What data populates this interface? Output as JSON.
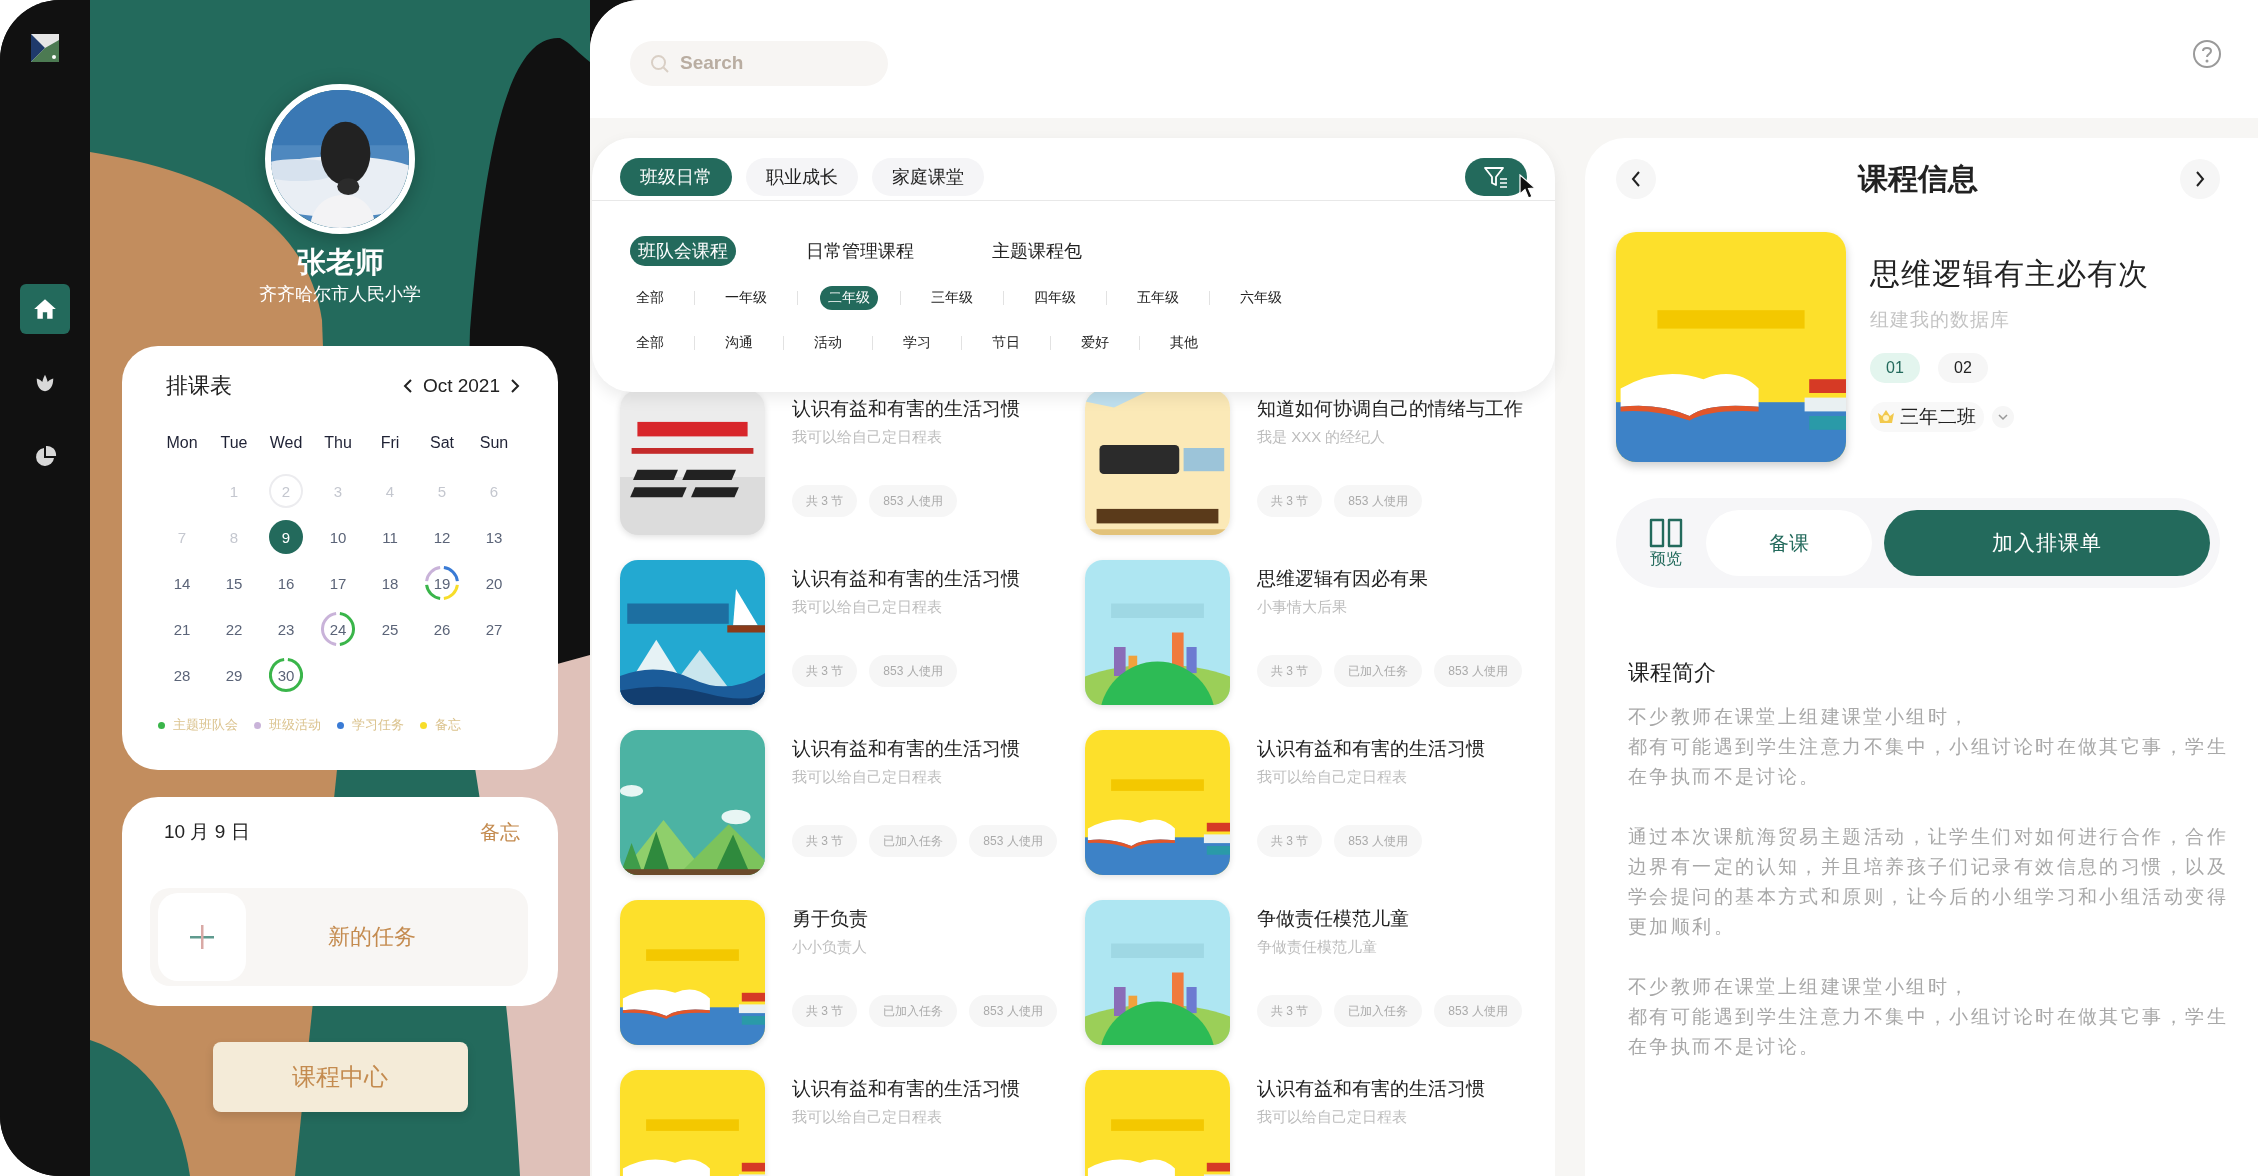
{
  "sidebar": {
    "nav_items": [
      {
        "selected": true
      },
      {
        "selected": false
      },
      {
        "selected": false
      }
    ]
  },
  "profile": {
    "name": "张老师",
    "school": "齐齐哈尔市人民小学"
  },
  "calendar": {
    "title": "排课表",
    "month": "Oct 2021",
    "weekdays": [
      "Mon",
      "Tue",
      "Wed",
      "Thu",
      "Fri",
      "Sat",
      "Sun"
    ],
    "days": [
      {
        "day": "1",
        "muted": true,
        "selected": false,
        "outlined": false
      },
      {
        "day": "2",
        "muted": true,
        "selected": false,
        "outlined": true
      },
      {
        "day": "3",
        "muted": true,
        "selected": false,
        "outlined": false
      },
      {
        "day": "4",
        "muted": true,
        "selected": false,
        "outlined": false
      },
      {
        "day": "5",
        "muted": true,
        "selected": false,
        "outlined": false
      },
      {
        "day": "6",
        "muted": true,
        "selected": false,
        "outlined": false
      },
      {
        "day": "7",
        "muted": true,
        "selected": false,
        "outlined": false
      },
      {
        "day": "8",
        "muted": true,
        "selected": false,
        "outlined": false
      },
      {
        "day": "9",
        "muted": false,
        "selected": true,
        "outlined": false
      },
      {
        "day": "10",
        "muted": false,
        "selected": false,
        "outlined": false
      },
      {
        "day": "11",
        "muted": false,
        "selected": false,
        "outlined": false
      },
      {
        "day": "12",
        "muted": false,
        "selected": false,
        "outlined": false
      },
      {
        "day": "13",
        "muted": false,
        "selected": false,
        "outlined": false
      },
      {
        "day": "14",
        "muted": false,
        "selected": false,
        "outlined": false
      },
      {
        "day": "15",
        "muted": false,
        "selected": false,
        "outlined": false
      },
      {
        "day": "16",
        "muted": false,
        "selected": false,
        "outlined": false
      },
      {
        "day": "17",
        "muted": false,
        "selected": false,
        "outlined": false
      },
      {
        "day": "18",
        "muted": false,
        "selected": false,
        "outlined": false
      },
      {
        "day": "19",
        "muted": false,
        "selected": false,
        "outlined": false,
        "events": [
          {
            "color": "#3a7bd5"
          },
          {
            "color": "#f7dd2a"
          },
          {
            "color": "#3ab54a"
          },
          {
            "color": "#c9b3d9"
          }
        ]
      },
      {
        "day": "20",
        "muted": false,
        "selected": false,
        "outlined": false
      },
      {
        "day": "21",
        "muted": false,
        "selected": false,
        "outlined": false
      },
      {
        "day": "22",
        "muted": false,
        "selected": false,
        "outlined": false
      },
      {
        "day": "23",
        "muted": false,
        "selected": false,
        "outlined": false
      },
      {
        "day": "24",
        "muted": false,
        "selected": false,
        "outlined": false,
        "events": [
          {
            "color": "#3ab54a"
          },
          {
            "color": "#c9b3d9"
          }
        ]
      },
      {
        "day": "25",
        "muted": false,
        "selected": false,
        "outlined": false
      },
      {
        "day": "26",
        "muted": false,
        "selected": false,
        "outlined": false
      },
      {
        "day": "27",
        "muted": false,
        "selected": false,
        "outlined": false
      },
      {
        "day": "28",
        "muted": false,
        "selected": false,
        "outlined": false
      },
      {
        "day": "29",
        "muted": false,
        "selected": false,
        "outlined": false
      },
      {
        "day": "30",
        "muted": false,
        "selected": false,
        "outlined": false,
        "events": [
          {
            "color": "#3ab54a"
          }
        ]
      }
    ],
    "legend": [
      {
        "label": "主题班队会",
        "color": "#3ab54a"
      },
      {
        "label": "班级活动",
        "color": "#c9b3d9"
      },
      {
        "label": "学习任务",
        "color": "#3a7bd5"
      },
      {
        "label": "备忘",
        "color": "#f7dd2a"
      }
    ]
  },
  "memo": {
    "date": "10 月 9 日",
    "action": "备忘",
    "new_task": "新的任务"
  },
  "course_center_button": "课程中心",
  "search": {
    "placeholder": "Search"
  },
  "tabs": [
    {
      "label": "班级日常",
      "selected": true
    },
    {
      "label": "职业成长",
      "selected": false
    },
    {
      "label": "家庭课堂",
      "selected": false
    }
  ],
  "filter_button": {
    "active": true
  },
  "filters": {
    "categories": [
      {
        "label": "班队会课程",
        "selected": true
      },
      {
        "label": "日常管理课程",
        "selected": false
      },
      {
        "label": "主题课程包",
        "selected": false
      }
    ],
    "grades": [
      {
        "label": "全部",
        "selected": false
      },
      {
        "label": "一年级",
        "selected": false
      },
      {
        "label": "二年级",
        "selected": true
      },
      {
        "label": "三年级",
        "selected": false
      },
      {
        "label": "四年级",
        "selected": false
      },
      {
        "label": "五年级",
        "selected": false
      },
      {
        "label": "六年级",
        "selected": false
      }
    ],
    "topics": [
      {
        "label": "全部",
        "selected": false
      },
      {
        "label": "沟通",
        "selected": false
      },
      {
        "label": "活动",
        "selected": false
      },
      {
        "label": "学习",
        "selected": false
      },
      {
        "label": "节日",
        "selected": false
      },
      {
        "label": "爱好",
        "selected": false
      },
      {
        "label": "其他",
        "selected": false
      }
    ]
  },
  "courses": [
    {
      "title": "认识有益和有害的生活习惯",
      "subtitle": "我可以给自己定日程表",
      "tags": [
        "共 3 节",
        "853 人使用"
      ]
    },
    {
      "title": "知道如何协调自己的情绪与工作",
      "subtitle": "我是 XXX 的经纪人",
      "tags": [
        "共 3 节",
        "853 人使用"
      ]
    },
    {
      "title": "认识有益和有害的生活习惯",
      "subtitle": "我可以给自己定日程表",
      "tags": [
        "共 3 节",
        "853 人使用"
      ]
    },
    {
      "title": "思维逻辑有因必有果",
      "subtitle": "小事情大后果",
      "tags": [
        "共 3 节",
        "已加入任务",
        "853 人使用"
      ]
    },
    {
      "title": "认识有益和有害的生活习惯",
      "subtitle": "我可以给自己定日程表",
      "tags": [
        "共 3 节",
        "已加入任务",
        "853 人使用"
      ]
    },
    {
      "title": "认识有益和有害的生活习惯",
      "subtitle": "我可以给自己定日程表",
      "tags": [
        "共 3 节",
        "853 人使用"
      ]
    },
    {
      "title": "勇于负责",
      "subtitle": "小小负责人",
      "tags": [
        "共 3 节",
        "已加入任务",
        "853 人使用"
      ]
    },
    {
      "title": "争做责任模范儿童",
      "subtitle": "争做责任模范儿童",
      "tags": [
        "共 3 节",
        "已加入任务",
        "853 人使用"
      ]
    },
    {
      "title": "认识有益和有害的生活习惯",
      "subtitle": "我可以给自己定日程表"
    },
    {
      "title": "认识有益和有害的生活习惯",
      "subtitle": "我可以给自己定日程表"
    }
  ],
  "detail": {
    "title": "课程信息",
    "course_title": "思维逻辑有主必有次",
    "course_subtitle": "组建我的数据库",
    "lessons": [
      {
        "label": "01",
        "selected": true
      },
      {
        "label": "02",
        "selected": false
      }
    ],
    "class_name": "三年二班",
    "preview": "预览",
    "prepare": "备课",
    "add": "加入排课单",
    "intro_title": "课程简介",
    "paragraphs": [
      {
        "lines": [
          "不少教师在课堂上组建课堂小组时，",
          "都有可能遇到学生注意力不集中，小组讨论时在做其它事，学生在争执而不是讨论。"
        ]
      },
      {
        "lines": [
          "通过本次课航海贸易主题活动，让学生们对如何进行合作，合作边界有一定的认知，并且培养孩子们记录有效信息的习惯，以及学会提问的基本方式和原则，让今后的小组学习和小组活动变得更加顺利。"
        ]
      },
      {
        "lines": [
          "不少教师在课堂上组建课堂小组时，",
          "都有可能遇到学生注意力不集中，小组讨论时在做其它事，学生在争执而不是讨论。"
        ]
      }
    ]
  }
}
